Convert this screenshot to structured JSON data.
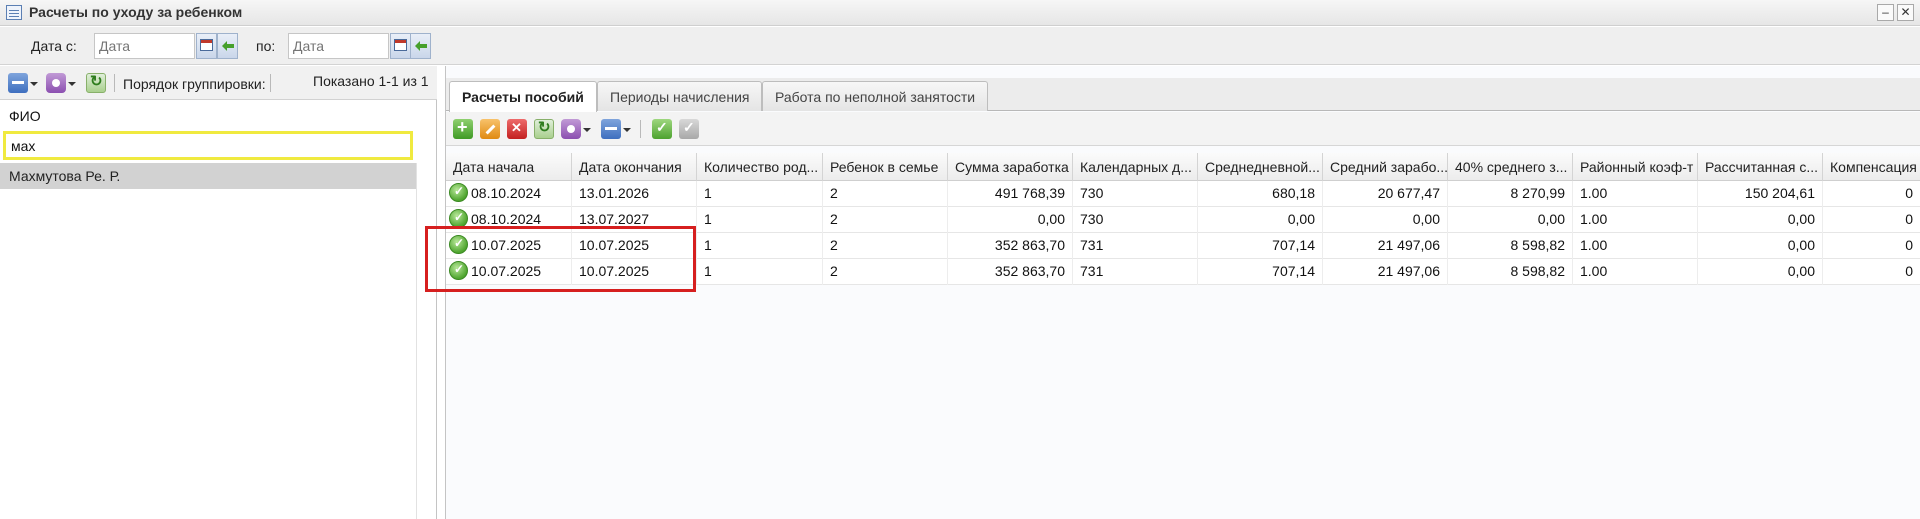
{
  "window": {
    "title": "Расчеты по уходу за ребенком"
  },
  "filter": {
    "date_from_label": "Дата с:",
    "date_from_placeholder": "Дата",
    "date_to_label": "по:",
    "date_to_placeholder": "Дата"
  },
  "left": {
    "grouping_label": "Порядок группировки:",
    "shown_label": "Показано 1-1 из 1",
    "fio_header": "ФИО",
    "fio_filter_value": "мах",
    "rows": [
      "Махмутова Ре. Р."
    ]
  },
  "tabs": [
    "Расчеты пособий",
    "Периоды начисления",
    "Работа по неполной занятости"
  ],
  "grid": {
    "columns": [
      "Дата начала",
      "Дата окончания",
      "Количество род...",
      "Ребенок в семье",
      "Сумма заработка",
      "Календарных д...",
      "Среднедневной...",
      "Средний зарабо...",
      "40% среднего з...",
      "Районный коэф-т",
      "Рассчитанная с...",
      "Компенсация"
    ],
    "rows": [
      [
        "08.10.2024",
        "13.01.2026",
        "1",
        "2",
        "491 768,39",
        "730",
        "680,18",
        "20 677,47",
        "8 270,99",
        "1.00",
        "150 204,61",
        "0"
      ],
      [
        "08.10.2024",
        "13.07.2027",
        "1",
        "2",
        "0,00",
        "730",
        "0,00",
        "0,00",
        "0,00",
        "1.00",
        "0,00",
        "0"
      ],
      [
        "10.07.2025",
        "10.07.2025",
        "1",
        "2",
        "352 863,70",
        "731",
        "707,14",
        "21 497,06",
        "8 598,82",
        "1.00",
        "0,00",
        "0"
      ],
      [
        "10.07.2025",
        "10.07.2025",
        "1",
        "2",
        "352 863,70",
        "731",
        "707,14",
        "21 497,06",
        "8 598,82",
        "1.00",
        "0,00",
        "0"
      ]
    ]
  },
  "colors": {
    "highlight": "#d61f1f",
    "filter_border": "#f0ea3f",
    "selected_row": "#d2d2d2"
  }
}
